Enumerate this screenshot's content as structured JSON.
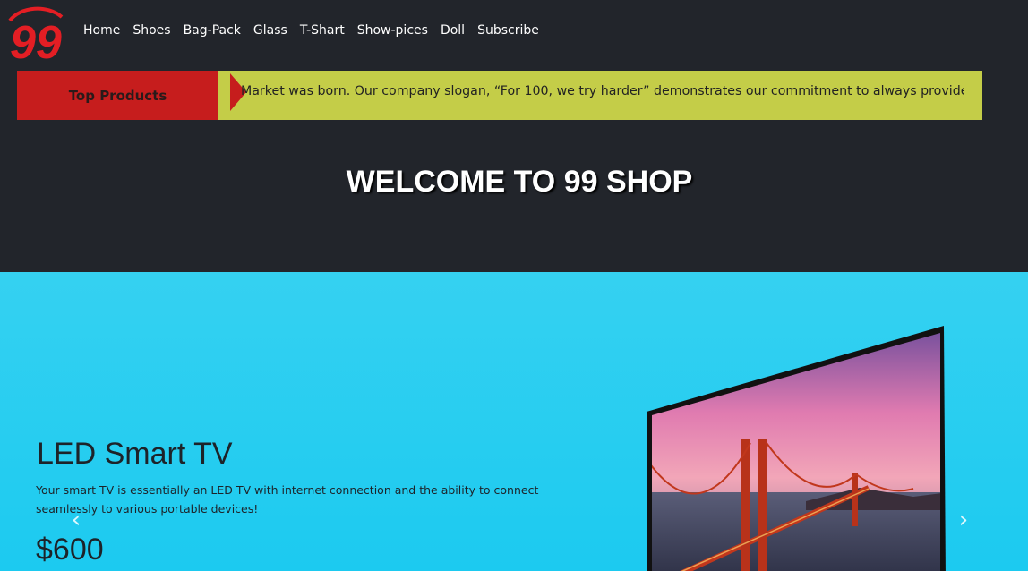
{
  "brand": {
    "logo_text": "99",
    "logo_color": "#e31e24"
  },
  "nav": {
    "items": [
      {
        "label": "Home"
      },
      {
        "label": "Shoes"
      },
      {
        "label": "Bag-Pack"
      },
      {
        "label": "Glass"
      },
      {
        "label": "T-Shart"
      },
      {
        "label": "Show-pices"
      },
      {
        "label": "Doll"
      },
      {
        "label": "Subscribe"
      }
    ]
  },
  "ticker": {
    "label": "Top Products",
    "text": "Market was born. Our company slogan, “For 100, we try harder” demonstrates our commitment to always provide"
  },
  "welcome": {
    "title": "WELCOME TO 99 SHOP"
  },
  "hero": {
    "product_title": "LED Smart TV",
    "description": "Your smart TV is essentially an LED TV with internet connection and the ability to connect seamlessly to various portable devices!",
    "price": "$600",
    "prev_icon": "chevron-left-icon",
    "next_icon": "chevron-right-icon",
    "prev_glyph": "‹",
    "next_glyph": "›"
  },
  "colors": {
    "header_bg": "#22252b",
    "ticker_bg": "#c4cd48",
    "ticker_label_bg": "#c61d1d",
    "hero_bg": "#28cdf0"
  }
}
